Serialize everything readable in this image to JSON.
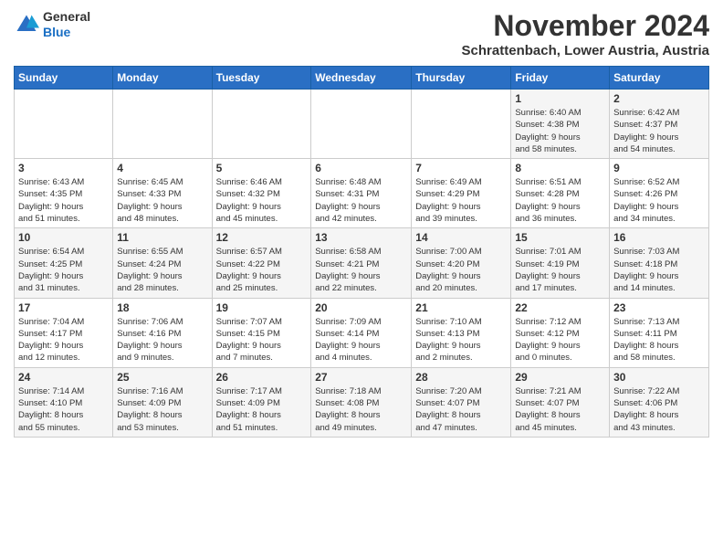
{
  "header": {
    "logo_line1": "General",
    "logo_line2": "Blue",
    "month": "November 2024",
    "location": "Schrattenbach, Lower Austria, Austria"
  },
  "weekdays": [
    "Sunday",
    "Monday",
    "Tuesday",
    "Wednesday",
    "Thursday",
    "Friday",
    "Saturday"
  ],
  "weeks": [
    [
      {
        "day": "",
        "info": ""
      },
      {
        "day": "",
        "info": ""
      },
      {
        "day": "",
        "info": ""
      },
      {
        "day": "",
        "info": ""
      },
      {
        "day": "",
        "info": ""
      },
      {
        "day": "1",
        "info": "Sunrise: 6:40 AM\nSunset: 4:38 PM\nDaylight: 9 hours\nand 58 minutes."
      },
      {
        "day": "2",
        "info": "Sunrise: 6:42 AM\nSunset: 4:37 PM\nDaylight: 9 hours\nand 54 minutes."
      }
    ],
    [
      {
        "day": "3",
        "info": "Sunrise: 6:43 AM\nSunset: 4:35 PM\nDaylight: 9 hours\nand 51 minutes."
      },
      {
        "day": "4",
        "info": "Sunrise: 6:45 AM\nSunset: 4:33 PM\nDaylight: 9 hours\nand 48 minutes."
      },
      {
        "day": "5",
        "info": "Sunrise: 6:46 AM\nSunset: 4:32 PM\nDaylight: 9 hours\nand 45 minutes."
      },
      {
        "day": "6",
        "info": "Sunrise: 6:48 AM\nSunset: 4:31 PM\nDaylight: 9 hours\nand 42 minutes."
      },
      {
        "day": "7",
        "info": "Sunrise: 6:49 AM\nSunset: 4:29 PM\nDaylight: 9 hours\nand 39 minutes."
      },
      {
        "day": "8",
        "info": "Sunrise: 6:51 AM\nSunset: 4:28 PM\nDaylight: 9 hours\nand 36 minutes."
      },
      {
        "day": "9",
        "info": "Sunrise: 6:52 AM\nSunset: 4:26 PM\nDaylight: 9 hours\nand 34 minutes."
      }
    ],
    [
      {
        "day": "10",
        "info": "Sunrise: 6:54 AM\nSunset: 4:25 PM\nDaylight: 9 hours\nand 31 minutes."
      },
      {
        "day": "11",
        "info": "Sunrise: 6:55 AM\nSunset: 4:24 PM\nDaylight: 9 hours\nand 28 minutes."
      },
      {
        "day": "12",
        "info": "Sunrise: 6:57 AM\nSunset: 4:22 PM\nDaylight: 9 hours\nand 25 minutes."
      },
      {
        "day": "13",
        "info": "Sunrise: 6:58 AM\nSunset: 4:21 PM\nDaylight: 9 hours\nand 22 minutes."
      },
      {
        "day": "14",
        "info": "Sunrise: 7:00 AM\nSunset: 4:20 PM\nDaylight: 9 hours\nand 20 minutes."
      },
      {
        "day": "15",
        "info": "Sunrise: 7:01 AM\nSunset: 4:19 PM\nDaylight: 9 hours\nand 17 minutes."
      },
      {
        "day": "16",
        "info": "Sunrise: 7:03 AM\nSunset: 4:18 PM\nDaylight: 9 hours\nand 14 minutes."
      }
    ],
    [
      {
        "day": "17",
        "info": "Sunrise: 7:04 AM\nSunset: 4:17 PM\nDaylight: 9 hours\nand 12 minutes."
      },
      {
        "day": "18",
        "info": "Sunrise: 7:06 AM\nSunset: 4:16 PM\nDaylight: 9 hours\nand 9 minutes."
      },
      {
        "day": "19",
        "info": "Sunrise: 7:07 AM\nSunset: 4:15 PM\nDaylight: 9 hours\nand 7 minutes."
      },
      {
        "day": "20",
        "info": "Sunrise: 7:09 AM\nSunset: 4:14 PM\nDaylight: 9 hours\nand 4 minutes."
      },
      {
        "day": "21",
        "info": "Sunrise: 7:10 AM\nSunset: 4:13 PM\nDaylight: 9 hours\nand 2 minutes."
      },
      {
        "day": "22",
        "info": "Sunrise: 7:12 AM\nSunset: 4:12 PM\nDaylight: 9 hours\nand 0 minutes."
      },
      {
        "day": "23",
        "info": "Sunrise: 7:13 AM\nSunset: 4:11 PM\nDaylight: 8 hours\nand 58 minutes."
      }
    ],
    [
      {
        "day": "24",
        "info": "Sunrise: 7:14 AM\nSunset: 4:10 PM\nDaylight: 8 hours\nand 55 minutes."
      },
      {
        "day": "25",
        "info": "Sunrise: 7:16 AM\nSunset: 4:09 PM\nDaylight: 8 hours\nand 53 minutes."
      },
      {
        "day": "26",
        "info": "Sunrise: 7:17 AM\nSunset: 4:09 PM\nDaylight: 8 hours\nand 51 minutes."
      },
      {
        "day": "27",
        "info": "Sunrise: 7:18 AM\nSunset: 4:08 PM\nDaylight: 8 hours\nand 49 minutes."
      },
      {
        "day": "28",
        "info": "Sunrise: 7:20 AM\nSunset: 4:07 PM\nDaylight: 8 hours\nand 47 minutes."
      },
      {
        "day": "29",
        "info": "Sunrise: 7:21 AM\nSunset: 4:07 PM\nDaylight: 8 hours\nand 45 minutes."
      },
      {
        "day": "30",
        "info": "Sunrise: 7:22 AM\nSunset: 4:06 PM\nDaylight: 8 hours\nand 43 minutes."
      }
    ]
  ]
}
